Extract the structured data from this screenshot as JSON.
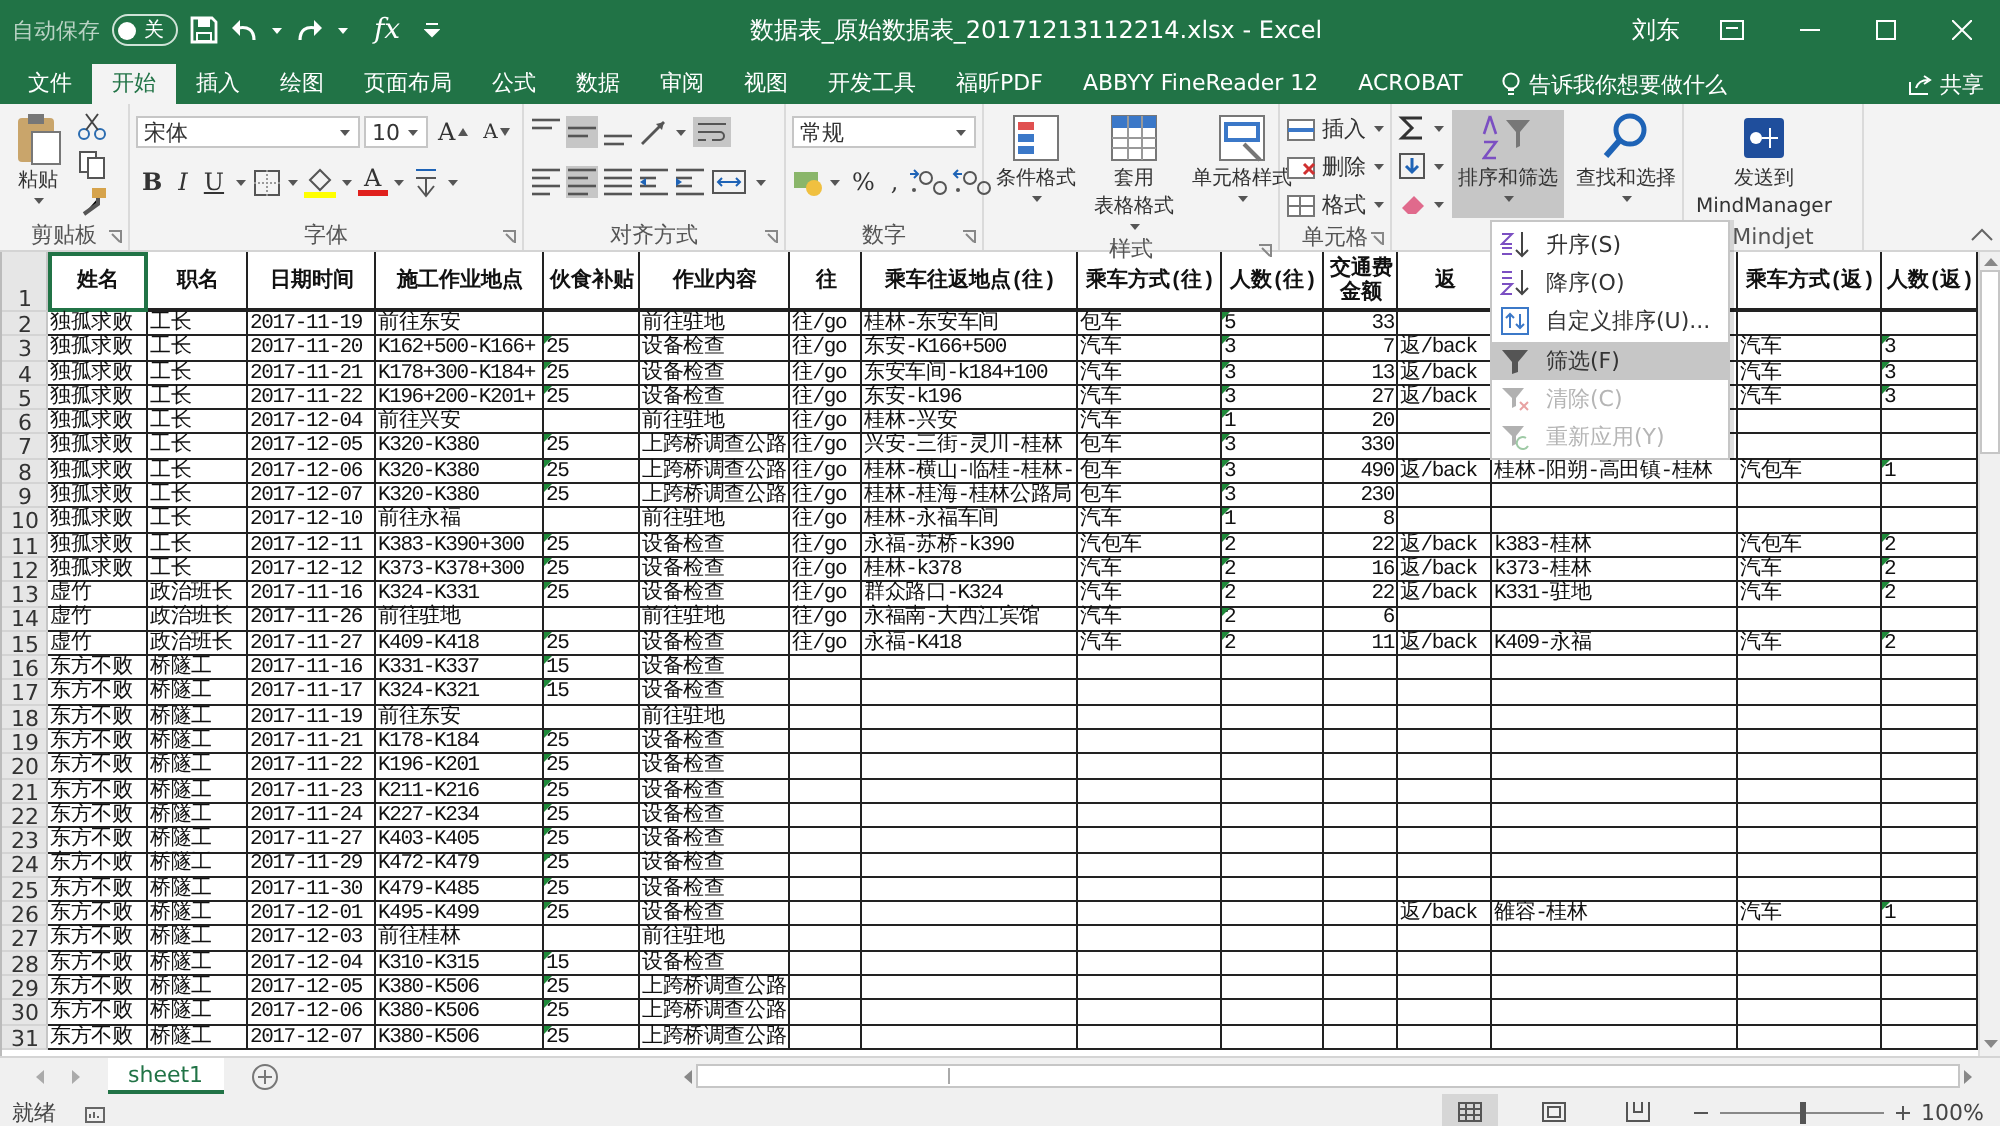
{
  "title_bar": {
    "autosave_label": "自动保存",
    "autosave": {
      "on": false,
      "label": "关"
    },
    "formula_symbol": "fx",
    "title": "数据表_原始数据表_20171213112214.xlsx  -  Excel",
    "user": "刘东"
  },
  "tabs": [
    {
      "label": "文件",
      "selected": false
    },
    {
      "label": "开始",
      "selected": true
    },
    {
      "label": "插入",
      "selected": false
    },
    {
      "label": "绘图",
      "selected": false
    },
    {
      "label": "页面布局",
      "selected": false
    },
    {
      "label": "公式",
      "selected": false
    },
    {
      "label": "数据",
      "selected": false
    },
    {
      "label": "审阅",
      "selected": false
    },
    {
      "label": "视图",
      "selected": false
    },
    {
      "label": "开发工具",
      "selected": false
    },
    {
      "label": "福昕PDF",
      "selected": false
    },
    {
      "label": "ABBYY FineReader 12",
      "selected": false
    },
    {
      "label": "ACROBAT",
      "selected": false
    }
  ],
  "tell_me": "告诉我你想要做什么",
  "share": "共享",
  "ribbon": [
    {
      "kind": "clipboard",
      "label": "剪贴板",
      "paste": "粘贴"
    },
    {
      "kind": "font",
      "label": "字体",
      "font_name": "宋体",
      "font_size": "10",
      "grow": "A",
      "shrink": "A",
      "bold": "B",
      "italic": "I",
      "underline": "U",
      "font_color": "A"
    },
    {
      "kind": "alignment",
      "label": "对齐方式"
    },
    {
      "kind": "number",
      "label": "数字",
      "format": "常规",
      "percent": "%",
      "comma": ","
    },
    {
      "kind": "styles",
      "label": "样式",
      "buttons": [
        [
          "条件格式"
        ],
        [
          "套用",
          "表格格式"
        ],
        [
          "单元格样式"
        ]
      ]
    },
    {
      "kind": "cells",
      "label": "单元格",
      "buttons": [
        "插入",
        "删除",
        "格式"
      ]
    },
    {
      "kind": "editing",
      "buttons": [
        {
          "label": "排序和筛选",
          "selected": true
        },
        {
          "label": "查找和选择",
          "selected": false
        }
      ]
    },
    {
      "kind": "mindjet",
      "label": "Mindjet",
      "button": [
        "发送到",
        "MindManager"
      ]
    }
  ],
  "menu": [
    {
      "label": "升序(S)",
      "selected": false,
      "disabled": false
    },
    {
      "label": "降序(O)",
      "selected": false,
      "disabled": false
    },
    {
      "label": "自定义排序(U)...",
      "selected": false,
      "disabled": false
    },
    {
      "label": "筛选(F)",
      "selected": true,
      "disabled": false
    },
    {
      "label": "清除(C)",
      "selected": false,
      "disabled": true
    },
    {
      "label": "重新应用(Y)",
      "selected": false,
      "disabled": true
    }
  ],
  "sheet": {
    "columns": [
      {
        "label": "姓名",
        "selected": true,
        "number_warning": false
      },
      {
        "label": "职名",
        "selected": false,
        "number_warning": false
      },
      {
        "label": "日期时间",
        "selected": false,
        "number_warning": false
      },
      {
        "label": "施工作业地点",
        "selected": false,
        "number_warning": false
      },
      {
        "label": "伙食补贴",
        "selected": false,
        "number_warning": true
      },
      {
        "label": "作业内容",
        "selected": false,
        "number_warning": false
      },
      {
        "label": "往",
        "selected": false,
        "number_warning": false
      },
      {
        "label": "乘车往返地点(往)",
        "selected": false,
        "number_warning": false
      },
      {
        "label": "乘车方式(往)",
        "selected": false,
        "number_warning": false
      },
      {
        "label": "人数(往)",
        "selected": false,
        "number_warning": true
      },
      {
        "label": "交通费金额",
        "selected": false,
        "number_warning": false
      },
      {
        "label": "返",
        "selected": false,
        "number_warning": false
      },
      {
        "selected": false,
        "number_warning": false
      },
      {
        "label": "乘车方式(返)",
        "selected": false,
        "number_warning": false
      },
      {
        "label": "人数(返)",
        "selected": false,
        "number_warning": true
      }
    ],
    "header_row": "1",
    "rows": [
      {
        "number": "2",
        "cells": {
          "name": "独孤求败",
          "title": "工长",
          "date": "2017-11-19",
          "site": "前往东安",
          "work": "前往驻地",
          "go": "往/go",
          "route_go": "桂林-东安车间",
          "mode_go": "包车",
          "count_go": "5",
          "fare": "33"
        }
      },
      {
        "number": "3",
        "cells": {
          "name": "独孤求败",
          "title": "工长",
          "date": "2017-11-20",
          "site": "K162+500-K166+",
          "meal": "25",
          "work": "设备检查",
          "go": "往/go",
          "route_go": "东安-K166+500",
          "mode_go": "汽车",
          "count_go": "3",
          "fare": "7",
          "back": "返/back",
          "mode_back": "汽车",
          "count_back": "3"
        }
      },
      {
        "number": "4",
        "cells": {
          "name": "独孤求败",
          "title": "工长",
          "date": "2017-11-21",
          "site": "K178+300-K184+",
          "meal": "25",
          "work": "设备检查",
          "go": "往/go",
          "route_go": "东安车间-k184+100",
          "mode_go": "汽车",
          "count_go": "3",
          "fare": "13",
          "back": "返/back",
          "mode_back": "汽车",
          "count_back": "3"
        }
      },
      {
        "number": "5",
        "cells": {
          "name": "独孤求败",
          "title": "工长",
          "date": "2017-11-22",
          "site": "K196+200-K201+",
          "meal": "25",
          "work": "设备检查",
          "go": "往/go",
          "route_go": "东安-k196",
          "mode_go": "汽车",
          "count_go": "3",
          "fare": "27",
          "back": "返/back",
          "mode_back": "汽车",
          "count_back": "3"
        }
      },
      {
        "number": "6",
        "cells": {
          "name": "独孤求败",
          "title": "工长",
          "date": "2017-12-04",
          "site": "前往兴安",
          "work": "前往驻地",
          "go": "往/go",
          "route_go": "桂林-兴安",
          "mode_go": "汽车",
          "count_go": "1",
          "fare": "20"
        }
      },
      {
        "number": "7",
        "cells": {
          "name": "独孤求败",
          "title": "工长",
          "date": "2017-12-05",
          "site": "K320-K380",
          "meal": "25",
          "work": "上跨桥调查公路",
          "go": "往/go",
          "route_go": "兴安-三街-灵川-桂林",
          "mode_go": "包车",
          "count_go": "3",
          "fare": "330"
        }
      },
      {
        "number": "8",
        "cells": {
          "name": "独孤求败",
          "title": "工长",
          "date": "2017-12-06",
          "site": "K320-K380",
          "meal": "25",
          "work": "上跨桥调查公路",
          "go": "往/go",
          "route_go": "桂林-横山-临桂-桂林-",
          "mode_go": "包车",
          "count_go": "3",
          "fare": "490",
          "back": "返/back",
          "column_13": "桂林-阳朔-高田镇-桂林",
          "mode_back": "汽包车",
          "count_back": "1"
        }
      },
      {
        "number": "9",
        "cells": {
          "name": "独孤求败",
          "title": "工长",
          "date": "2017-12-07",
          "site": "K320-K380",
          "meal": "25",
          "work": "上跨桥调查公路",
          "go": "往/go",
          "route_go": "桂林-桂海-桂林公路局",
          "mode_go": "包车",
          "count_go": "3",
          "fare": "230"
        }
      },
      {
        "number": "10",
        "cells": {
          "name": "独孤求败",
          "title": "工长",
          "date": "2017-12-10",
          "site": "前往永福",
          "work": "前往驻地",
          "go": "往/go",
          "route_go": "桂林-永福车间",
          "mode_go": "汽车",
          "count_go": "1",
          "fare": "8"
        }
      },
      {
        "number": "11",
        "cells": {
          "name": "独孤求败",
          "title": "工长",
          "date": "2017-12-11",
          "site": "K383-K390+300",
          "meal": "25",
          "work": "设备检查",
          "go": "往/go",
          "route_go": "永福-苏桥-k390",
          "mode_go": "汽包车",
          "count_go": "2",
          "fare": "22",
          "back": "返/back",
          "column_13": "k383-桂林",
          "mode_back": "汽包车",
          "count_back": "2"
        }
      },
      {
        "number": "12",
        "cells": {
          "name": "独孤求败",
          "title": "工长",
          "date": "2017-12-12",
          "site": "K373-K378+300",
          "meal": "25",
          "work": "设备检查",
          "go": "往/go",
          "route_go": "桂林-k378",
          "mode_go": "汽车",
          "count_go": "2",
          "fare": "16",
          "back": "返/back",
          "column_13": "k373-桂林",
          "mode_back": "汽车",
          "count_back": "2"
        }
      },
      {
        "number": "13",
        "cells": {
          "name": "虚竹",
          "title": "政治班长",
          "date": "2017-11-16",
          "site": "K324-K331",
          "meal": "25",
          "work": "设备检查",
          "go": "往/go",
          "route_go": "群众路口-K324",
          "mode_go": "汽车",
          "count_go": "2",
          "fare": "22",
          "back": "返/back",
          "column_13": "K331-驻地",
          "mode_back": "汽车",
          "count_back": "2"
        }
      },
      {
        "number": "14",
        "cells": {
          "name": "虚竹",
          "title": "政治班长",
          "date": "2017-11-26",
          "site": "前往驻地",
          "work": "前往驻地",
          "go": "往/go",
          "route_go": "永福南-大西江宾馆",
          "mode_go": "汽车",
          "count_go": "2",
          "fare": "6"
        }
      },
      {
        "number": "15",
        "cells": {
          "name": "虚竹",
          "title": "政治班长",
          "date": "2017-11-27",
          "site": "K409-K418",
          "meal": "25",
          "work": "设备检查",
          "go": "往/go",
          "route_go": "永福-K418",
          "mode_go": "汽车",
          "count_go": "2",
          "fare": "11",
          "back": "返/back",
          "column_13": "K409-永福",
          "mode_back": "汽车",
          "count_back": "2"
        }
      },
      {
        "number": "16",
        "cells": {
          "name": "东方不败",
          "title": "桥隧工",
          "date": "2017-11-16",
          "site": "K331-K337",
          "meal": "15",
          "work": "设备检查"
        }
      },
      {
        "number": "17",
        "cells": {
          "name": "东方不败",
          "title": "桥隧工",
          "date": "2017-11-17",
          "site": "K324-K321",
          "meal": "15",
          "work": "设备检查"
        }
      },
      {
        "number": "18",
        "cells": {
          "name": "东方不败",
          "title": "桥隧工",
          "date": "2017-11-19",
          "site": "前往东安",
          "work": "前往驻地"
        }
      },
      {
        "number": "19",
        "cells": {
          "name": "东方不败",
          "title": "桥隧工",
          "date": "2017-11-21",
          "site": "K178-K184",
          "meal": "25",
          "work": "设备检查"
        }
      },
      {
        "number": "20",
        "cells": {
          "name": "东方不败",
          "title": "桥隧工",
          "date": "2017-11-22",
          "site": "K196-K201",
          "meal": "25",
          "work": "设备检查"
        }
      },
      {
        "number": "21",
        "cells": {
          "name": "东方不败",
          "title": "桥隧工",
          "date": "2017-11-23",
          "site": "K211-K216",
          "meal": "25",
          "work": "设备检查"
        }
      },
      {
        "number": "22",
        "cells": {
          "name": "东方不败",
          "title": "桥隧工",
          "date": "2017-11-24",
          "site": "K227-K234",
          "meal": "25",
          "work": "设备检查"
        }
      },
      {
        "number": "23",
        "cells": {
          "name": "东方不败",
          "title": "桥隧工",
          "date": "2017-11-27",
          "site": "K403-K405",
          "meal": "25",
          "work": "设备检查"
        }
      },
      {
        "number": "24",
        "cells": {
          "name": "东方不败",
          "title": "桥隧工",
          "date": "2017-11-29",
          "site": "K472-K479",
          "meal": "25",
          "work": "设备检查"
        }
      },
      {
        "number": "25",
        "cells": {
          "name": "东方不败",
          "title": "桥隧工",
          "date": "2017-11-30",
          "site": "K479-K485",
          "meal": "25",
          "work": "设备检查"
        }
      },
      {
        "number": "26",
        "cells": {
          "name": "东方不败",
          "title": "桥隧工",
          "date": "2017-12-01",
          "site": "K495-K499",
          "meal": "25",
          "work": "设备检查",
          "back": "返/back",
          "column_13": "雒容-桂林",
          "mode_back": "汽车",
          "count_back": "1"
        }
      },
      {
        "number": "27",
        "cells": {
          "name": "东方不败",
          "title": "桥隧工",
          "date": "2017-12-03",
          "site": "前往桂林",
          "work": "前往驻地"
        }
      },
      {
        "number": "28",
        "cells": {
          "name": "东方不败",
          "title": "桥隧工",
          "date": "2017-12-04",
          "site": "K310-K315",
          "meal": "15",
          "work": "设备检查"
        }
      },
      {
        "number": "29",
        "cells": {
          "name": "东方不败",
          "title": "桥隧工",
          "date": "2017-12-05",
          "site": "K380-K506",
          "meal": "25",
          "work": "上跨桥调查公路"
        }
      },
      {
        "number": "30",
        "cells": {
          "name": "东方不败",
          "title": "桥隧工",
          "date": "2017-12-06",
          "site": "K380-K506",
          "meal": "25",
          "work": "上跨桥调查公路"
        }
      },
      {
        "number": "31",
        "cells": {
          "name": "东方不败",
          "title": "桥隧工",
          "date": "2017-12-07",
          "site": "K380-K506",
          "meal": "25",
          "work": "上跨桥调查公路"
        }
      }
    ]
  },
  "sheet_tabs": [
    {
      "label": "sheet1",
      "selected": true
    }
  ],
  "status_bar": {
    "status": "就绪",
    "zoom": {
      "level": 0.5,
      "reading": "100%"
    }
  }
}
